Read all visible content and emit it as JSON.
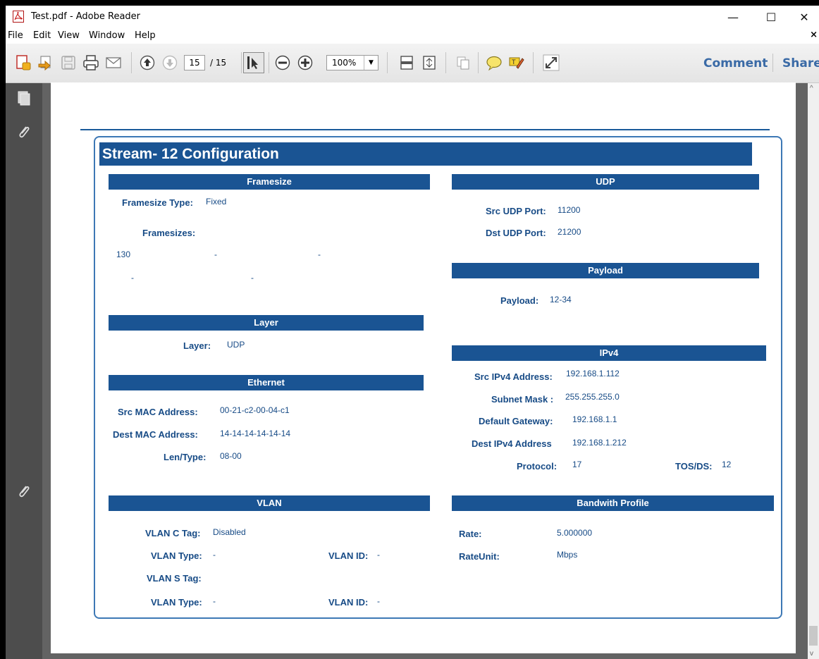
{
  "window": {
    "title": "Test.pdf - Adobe Reader",
    "minimize": "—",
    "maximize": "☐",
    "close": "✕"
  },
  "menu": {
    "items": [
      "File",
      "Edit",
      "View",
      "Window",
      "Help"
    ],
    "close_doc": "×"
  },
  "toolbar": {
    "page_current": "15",
    "page_total": "/ 15",
    "zoom": "100%",
    "comment": "Comment",
    "share": "Share",
    "icons": [
      "create-pdf-icon",
      "open-file-icon",
      "save-icon",
      "print-icon",
      "email-icon",
      "previous-page-icon",
      "next-page-icon",
      "select-tool-icon",
      "zoom-out-icon",
      "zoom-in-icon",
      "fit-page-icon",
      "full-screen-icon",
      "copy-icon",
      "sticky-note-icon",
      "highlight-icon",
      "read-mode-icon"
    ]
  },
  "doc": {
    "title": "Stream- 12  Configuration",
    "framesize": {
      "header": "Framesize",
      "type_label": "Framesize Type:",
      "type_value": "Fixed",
      "sizes_label": "Framesizes:",
      "row1": [
        "130",
        "-",
        "-"
      ],
      "row2": [
        "-",
        "-"
      ]
    },
    "layer": {
      "header": "Layer",
      "label": "Layer:",
      "value": "UDP"
    },
    "ethernet": {
      "header": "Ethernet",
      "src_mac_label": "Src MAC Address:",
      "src_mac_value": "00-21-c2-00-04-c1",
      "dest_mac_label": "Dest MAC Address:",
      "dest_mac_value": "14-14-14-14-14-14",
      "lentype_label": "Len/Type:",
      "lentype_value": "08-00"
    },
    "vlan": {
      "header": "VLAN",
      "ctag_label": "VLAN C Tag:",
      "ctag_value": "Disabled",
      "type1_label": "VLAN Type:",
      "type1_value": "-",
      "id1_label": "VLAN ID:",
      "id1_value": "-",
      "stag_label": "VLAN S Tag:",
      "type2_label": "VLAN Type:",
      "type2_value": "-",
      "id2_label": "VLAN ID:",
      "id2_value": "-"
    },
    "udp": {
      "header": "UDP",
      "src_label": "Src UDP Port:",
      "src_value": "11200",
      "dst_label": "Dst UDP Port:",
      "dst_value": "21200"
    },
    "payload": {
      "header": "Payload",
      "label": "Payload:",
      "value": "12-34"
    },
    "ipv4": {
      "header": "IPv4",
      "src_label": "Src IPv4 Address:",
      "src_value": "192.168.1.112",
      "mask_label": "Subnet Mask :",
      "mask_value": "255.255.255.0",
      "gw_label": "Default Gateway:",
      "gw_value": "192.168.1.1",
      "dest_label": "Dest IPv4 Address",
      "dest_value": "192.168.1.212",
      "proto_label": "Protocol:",
      "proto_value": "17",
      "tos_label": "TOS/DS:",
      "tos_value": "12"
    },
    "bandwidth": {
      "header": "Bandwith Profile",
      "rate_label": "Rate:",
      "rate_value": "5.000000",
      "unit_label": "RateUnit:",
      "unit_value": "Mbps"
    }
  },
  "colors": {
    "header_blue": "#1a5493",
    "label_blue": "#174b86",
    "link_blue": "#3a6aa6",
    "viewer_gray": "#636363",
    "nav_gray": "#4d4d4d"
  }
}
